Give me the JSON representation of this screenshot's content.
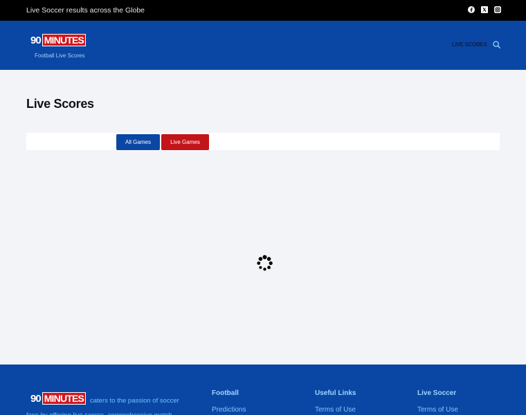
{
  "topbar": {
    "tagline": "Live Soccer results across the Globe",
    "social_icons": [
      "facebook-icon",
      "x-icon",
      "instagram-icon"
    ]
  },
  "header": {
    "logo_number": "90",
    "logo_word": "MINUTES",
    "logo_subtitle": "Football Live Scores",
    "nav_live_scores": "LIVE SCORES",
    "search_icon": "search-icon"
  },
  "main": {
    "title": "Live Scores",
    "tabs": [
      {
        "label": "All Games"
      },
      {
        "label": "Live Games"
      }
    ],
    "loading_icon": "loading-spinner-icon"
  },
  "footer": {
    "logo_number": "90",
    "logo_word": "MINUTES",
    "about": "caters to the passion of soccer fans by offering live scores, comprehensive match",
    "columns": [
      {
        "heading": "Football",
        "first_link": "Predictions"
      },
      {
        "heading": "Useful Links",
        "first_link": "Terms of Use"
      },
      {
        "heading": "Live Soccer",
        "first_link": "Terms of Use"
      }
    ]
  },
  "colors": {
    "brand_blue": "#0a47a4",
    "brand_red": "#c21419",
    "topbar": "#000000",
    "page_bg": "#f3f4f8"
  }
}
